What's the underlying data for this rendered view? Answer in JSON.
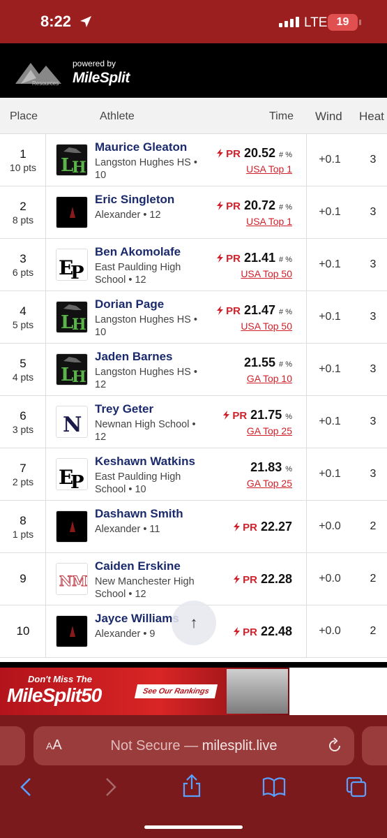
{
  "status_bar": {
    "time": "8:22",
    "carrier": "LTE",
    "battery": "19"
  },
  "header": {
    "logo_text": "Resources",
    "powered_by": "powered by",
    "brand": "MileSplit"
  },
  "table": {
    "headers": {
      "place": "Place",
      "athlete": "Athlete",
      "time": "Time",
      "wind": "Wind",
      "heat": "Heat"
    },
    "rows": [
      {
        "place": "1",
        "pts": "10 pts",
        "name": "Maurice Gleaton",
        "school": "Langston Hughes HS • 10",
        "logo": "LH",
        "pr": "PR",
        "time": "20.52",
        "marks": "# %",
        "rank": "USA Top 1",
        "wind": "+0.1",
        "heat": "3"
      },
      {
        "place": "2",
        "pts": "8 pts",
        "name": "Eric Singleton",
        "school": "Alexander • 12",
        "logo": "A",
        "pr": "PR",
        "time": "20.72",
        "marks": "# %",
        "rank": "USA Top 1",
        "wind": "+0.1",
        "heat": "3"
      },
      {
        "place": "3",
        "pts": "6 pts",
        "name": "Ben Akomolafe",
        "school": "East Paulding High School • 12",
        "logo": "EP",
        "pr": "PR",
        "time": "21.41",
        "marks": "# %",
        "rank": "USA Top 50",
        "wind": "+0.1",
        "heat": "3"
      },
      {
        "place": "4",
        "pts": "5 pts",
        "name": "Dorian Page",
        "school": "Langston Hughes HS • 10",
        "logo": "LH",
        "pr": "PR",
        "time": "21.47",
        "marks": "# %",
        "rank": "USA Top 50",
        "wind": "+0.1",
        "heat": "3"
      },
      {
        "place": "5",
        "pts": "4 pts",
        "name": "Jaden Barnes",
        "school": "Langston Hughes HS • 12",
        "logo": "LH",
        "pr": "",
        "time": "21.55",
        "marks": "# %",
        "rank": "GA Top 10",
        "wind": "+0.1",
        "heat": "3"
      },
      {
        "place": "6",
        "pts": "3 pts",
        "name": "Trey Geter",
        "school": "Newnan High School • 12",
        "logo": "N",
        "pr": "PR",
        "time": "21.75",
        "marks": "%",
        "rank": "GA Top 25",
        "wind": "+0.1",
        "heat": "3"
      },
      {
        "place": "7",
        "pts": "2 pts",
        "name": "Keshawn Watkins",
        "school": "East Paulding High School • 10",
        "logo": "EP",
        "pr": "",
        "time": "21.83",
        "marks": "%",
        "rank": "GA Top 25",
        "wind": "+0.1",
        "heat": "3"
      },
      {
        "place": "8",
        "pts": "1 pts",
        "name": "Dashawn Smith",
        "school": "Alexander • 11",
        "logo": "A",
        "pr": "PR",
        "time": "22.27",
        "marks": "",
        "rank": "",
        "wind": "+0.0",
        "heat": "2"
      },
      {
        "place": "9",
        "pts": "",
        "name": "Caiden Erskine",
        "school": "New Manchester High School • 12",
        "logo": "NM",
        "pr": "PR",
        "time": "22.28",
        "marks": "",
        "rank": "",
        "wind": "+0.0",
        "heat": "2"
      },
      {
        "place": "10",
        "pts": "",
        "name": "Jayce Williams",
        "school": "Alexander • 9",
        "logo": "A",
        "pr": "PR",
        "time": "22.48",
        "marks": "",
        "rank": "",
        "wind": "+0.0",
        "heat": "2"
      }
    ]
  },
  "ad": {
    "top_line": "Don't Miss The",
    "brand": "MileSplit50",
    "cta": "See Our Rankings"
  },
  "browser": {
    "aa_label": "AA",
    "security": "Not Secure",
    "separator": " — ",
    "domain": "milesplit.live"
  },
  "colors": {
    "status_bar": "#9b1f1f",
    "header": "#000000",
    "accent": "#d0202a",
    "name": "#1a2a6c",
    "safari": "#7b1a1c"
  }
}
